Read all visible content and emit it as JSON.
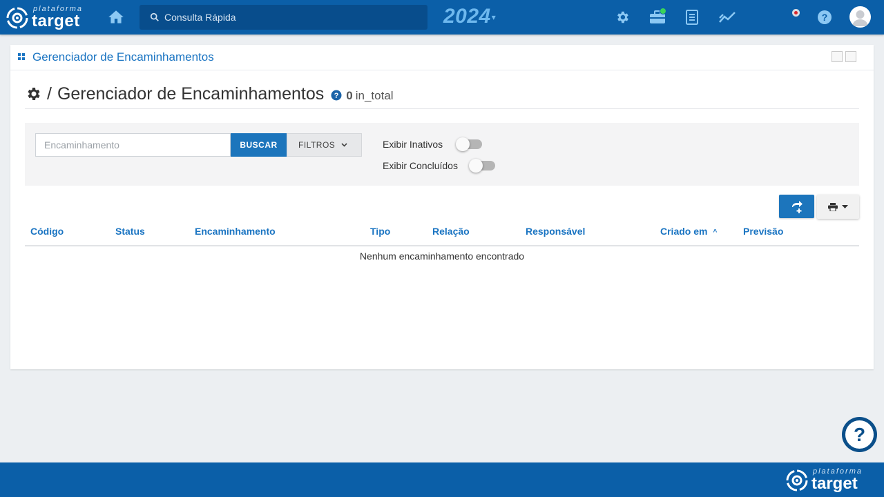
{
  "brand": {
    "small": "plataforma",
    "name": "target"
  },
  "topbar": {
    "search_placeholder": "Consulta Rápida",
    "year": "2024",
    "icons": [
      "home-icon",
      "search-icon",
      "gear-icon",
      "briefcase-icon",
      "document-icon",
      "trend-icon",
      "record-icon",
      "help-icon",
      "user-icon"
    ]
  },
  "panel": {
    "title": "Gerenciador de Encaminhamentos"
  },
  "page": {
    "prefix": "/",
    "title": "Gerenciador de Encaminhamentos",
    "count": "0",
    "count_suffix": "in_total"
  },
  "filters": {
    "input_placeholder": "Encaminhamento",
    "search_label": "BUSCAR",
    "filters_label": "FILTROS",
    "toggle_inativos": "Exibir Inativos",
    "toggle_concluidos": "Exibir Concluídos"
  },
  "table": {
    "columns": [
      "Código",
      "Status",
      "Encaminhamento",
      "Tipo",
      "Relação",
      "Responsável",
      "Criado em",
      "Previsão"
    ],
    "empty_message": "Nenhum encaminhamento encontrado"
  },
  "footer": {
    "small": "plataforma",
    "name": "target"
  },
  "colors": {
    "primary": "#0b5fa8",
    "accent": "#1c75bc",
    "year": "#6eb8ee"
  }
}
